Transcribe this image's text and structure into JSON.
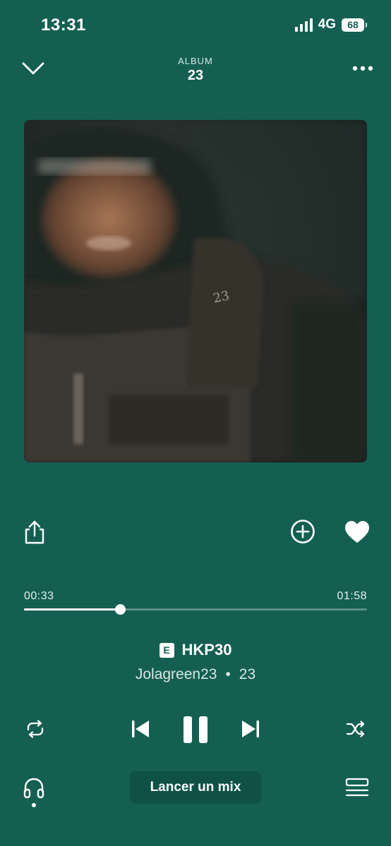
{
  "status_bar": {
    "time": "13:31",
    "network": "4G",
    "battery": "68"
  },
  "header": {
    "label": "ALBUM",
    "title": "23"
  },
  "icons": {
    "collapse": "chevron-down-icon",
    "more": "more-horizontal-icon",
    "share": "share-icon",
    "add": "add-circle-icon",
    "like": "heart-icon",
    "repeat": "repeat-icon",
    "previous": "skip-previous-icon",
    "pause": "pause-icon",
    "next": "skip-next-icon",
    "shuffle": "shuffle-icon",
    "output": "headphones-icon",
    "queue": "queue-icon"
  },
  "player": {
    "current_time": "00:33",
    "total_time": "01:58",
    "progress_fraction": 0.28,
    "explicit_badge": "E",
    "track_title": "HKP30",
    "artist": "Jolagreen23",
    "separator": "•",
    "album": "23"
  },
  "footer": {
    "mix_button": "Lancer un mix"
  },
  "colors": {
    "background": "#145f52",
    "accent": "#ffffff",
    "mix_button_bg": "#0f5146"
  }
}
